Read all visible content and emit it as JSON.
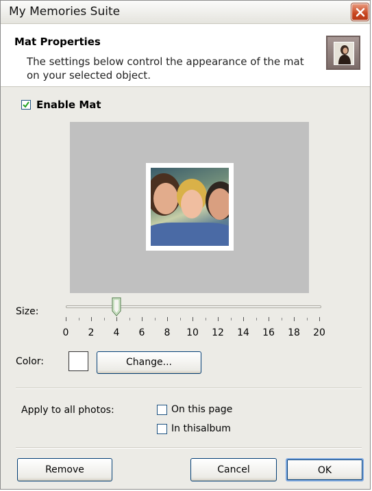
{
  "window": {
    "title": "My Memories Suite",
    "close_icon": "close-icon"
  },
  "header": {
    "title": "Mat Properties",
    "description": "The settings below control the appearance of the mat on your selected object.",
    "icon": "portrait-frame-icon"
  },
  "enable_mat": {
    "label": "Enable Mat",
    "checked": true
  },
  "size": {
    "label": "Size:",
    "value": 4,
    "min": 0,
    "max": 20,
    "tick_labels": [
      "0",
      "2",
      "4",
      "6",
      "8",
      "10",
      "12",
      "14",
      "16",
      "18",
      "20"
    ]
  },
  "color": {
    "label": "Color:",
    "value": "#ffffff",
    "change_label": "Change..."
  },
  "apply": {
    "label": "Apply to all photos:",
    "on_page": {
      "label": "On this page",
      "checked": false
    },
    "in_album": {
      "label": "In thisalbum",
      "checked": false
    }
  },
  "buttons": {
    "remove": "Remove",
    "cancel": "Cancel",
    "ok": "OK"
  }
}
